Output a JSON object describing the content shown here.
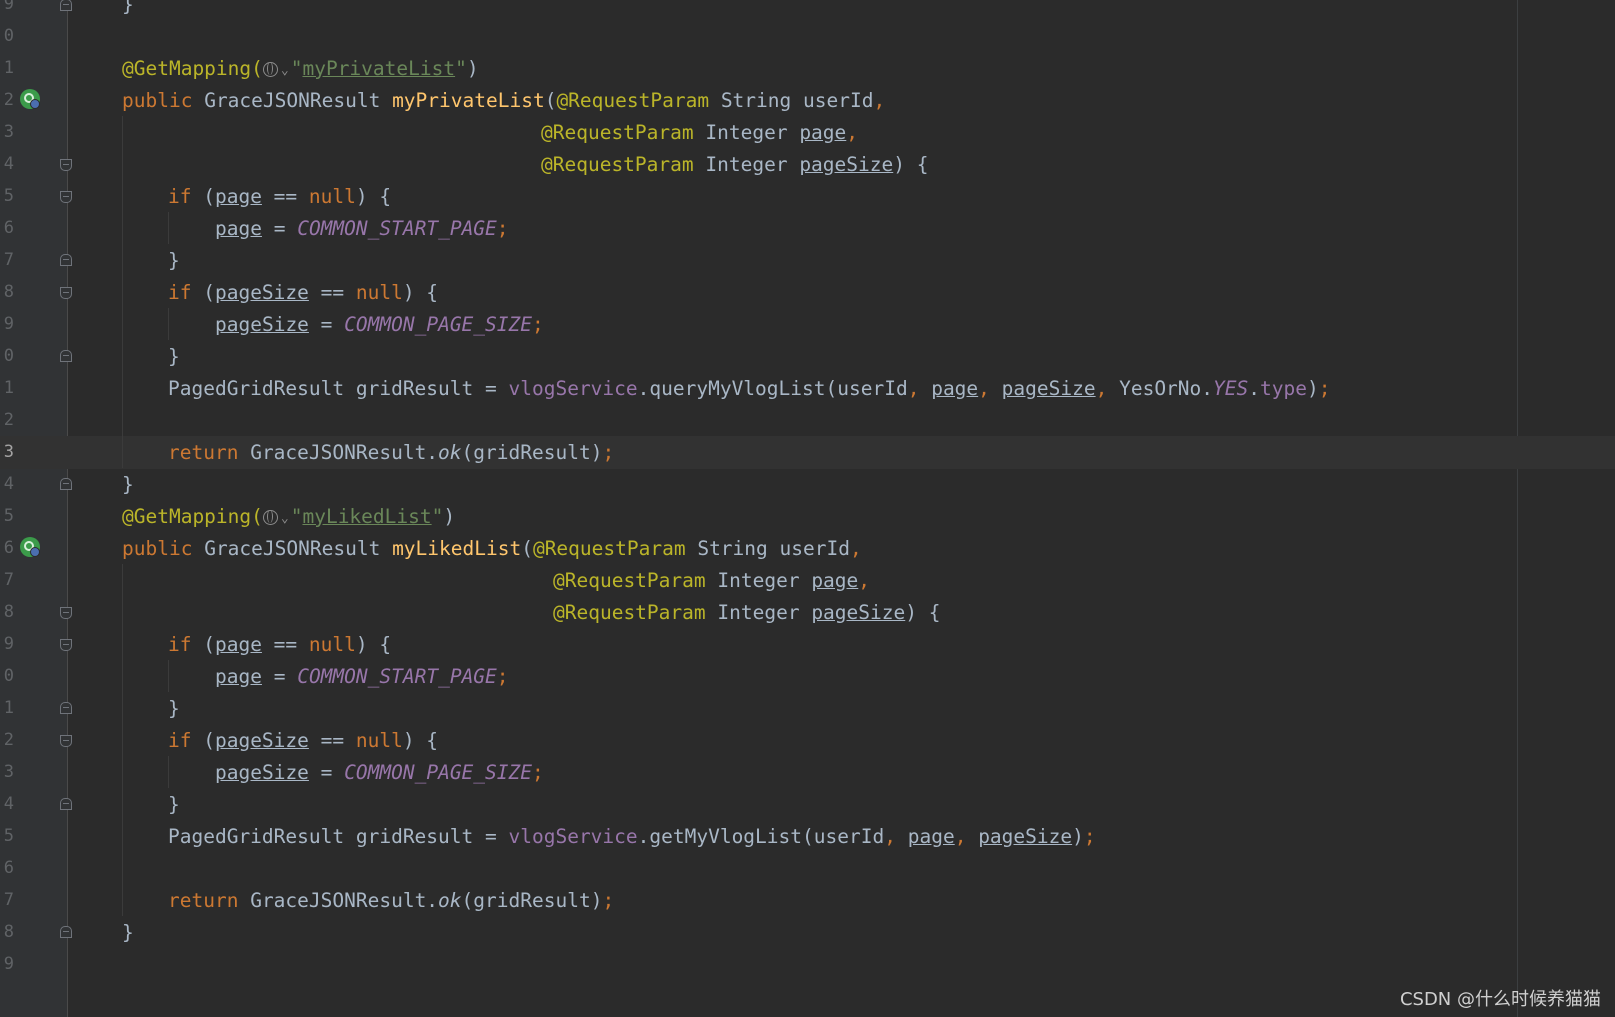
{
  "editor": {
    "current_line_index": 14,
    "lines": [
      {
        "no": "9"
      },
      {
        "no": "0"
      },
      {
        "no": "1"
      },
      {
        "no": "2"
      },
      {
        "no": "3"
      },
      {
        "no": "4"
      },
      {
        "no": "5"
      },
      {
        "no": "6"
      },
      {
        "no": "7"
      },
      {
        "no": "8"
      },
      {
        "no": "9"
      },
      {
        "no": "0"
      },
      {
        "no": "1"
      },
      {
        "no": "2"
      },
      {
        "no": "3"
      },
      {
        "no": "4"
      },
      {
        "no": "5"
      },
      {
        "no": "6"
      },
      {
        "no": "7"
      },
      {
        "no": "8"
      },
      {
        "no": "9"
      },
      {
        "no": "0"
      },
      {
        "no": "1"
      },
      {
        "no": "2"
      },
      {
        "no": "3"
      },
      {
        "no": "4"
      },
      {
        "no": "5"
      },
      {
        "no": "6"
      },
      {
        "no": "7"
      },
      {
        "no": "8"
      },
      {
        "no": "9"
      }
    ],
    "method1": {
      "mapping_annotation": "@GetMapping(",
      "mapping_path": "myPrivateList",
      "signature_public": "public",
      "return_type": "GraceJSONResult",
      "method_name": "myPrivateList",
      "service_call": "queryMyVlogList",
      "extra_arg_class": "YesOrNo.",
      "extra_arg_const": "YES",
      "extra_arg_field": "type"
    },
    "method2": {
      "mapping_annotation": "@GetMapping(",
      "mapping_path": "myLikedList",
      "signature_public": "public",
      "return_type": "GraceJSONResult",
      "method_name": "myLikedList",
      "service_call": "getMyVlogList"
    },
    "tokens": {
      "request_param": "@RequestParam",
      "string_type": "String",
      "integer_type": "Integer",
      "user_id": "userId",
      "page": "page",
      "page_size": "pageSize",
      "kw_if": "if",
      "kw_null": "null",
      "kw_return": "return",
      "start_page_const": "COMMON_START_PAGE",
      "page_size_const": "COMMON_PAGE_SIZE",
      "paged_grid_result": "PagedGridResult",
      "grid_result": "gridResult",
      "vlog_service": "vlogService",
      "grace_result": "GraceJSONResult.",
      "ok": "ok"
    }
  },
  "watermark": "CSDN @什么时候养猫猫",
  "colors": {
    "background": "#2b2b2b",
    "gutter": "#313335",
    "keyword": "#cc7832",
    "annotation": "#bbb529",
    "method": "#ffc66d",
    "string": "#6a8759",
    "constant": "#9876aa",
    "text": "#a9b7c6"
  }
}
